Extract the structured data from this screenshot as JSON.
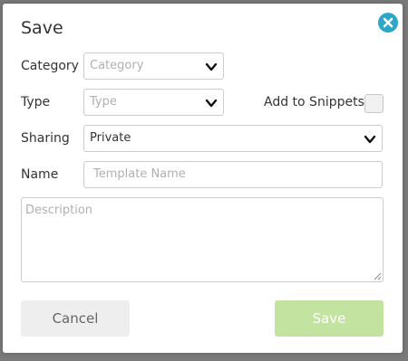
{
  "dialog": {
    "title": "Save",
    "close_icon": "close-circle-icon"
  },
  "form": {
    "category": {
      "label": "Category",
      "placeholder": "Category",
      "icon": "chevron-down-icon"
    },
    "type": {
      "label": "Type",
      "placeholder": "Type",
      "icon": "chevron-down-icon"
    },
    "add_to_snippets": {
      "label": "Add to Snippets",
      "checked": false
    },
    "sharing": {
      "label": "Sharing",
      "value": "Private",
      "icon": "chevron-down-icon"
    },
    "name": {
      "label": "Name",
      "placeholder": "Template Name"
    },
    "description": {
      "placeholder": "Description"
    }
  },
  "buttons": {
    "cancel": "Cancel",
    "save": "Save"
  },
  "colors": {
    "accent": "#2ea7c7",
    "save_button": "#c3e3a0",
    "cancel_button": "#eeeeee"
  }
}
